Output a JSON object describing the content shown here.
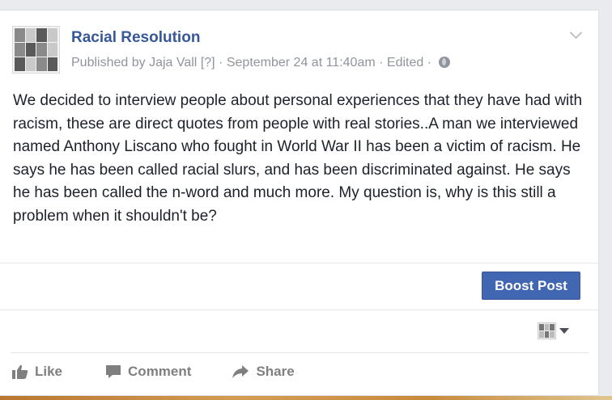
{
  "post": {
    "page_name": "Racial Resolution",
    "meta": {
      "published_by_prefix": "Published by ",
      "author": "Jaja Vall",
      "help_marker": "[?]",
      "separator": "·",
      "timestamp": "September 24 at 11:40am",
      "edited": "Edited"
    },
    "text": "We decided to interview people about personal experiences that they have had with racism, these are direct quotes from people with real stories..A man we interviewed named Anthony Liscano who fought in World War II has been a victim of racism. He says he has been called racial slurs, and has been discriminated against. He says he has been called the n-word and much more. My question is, why is this still a problem when it shouldn't be?",
    "boost_label": "Boost Post"
  },
  "actions": {
    "like": "Like",
    "comment": "Comment",
    "share": "Share"
  },
  "icons": {
    "options": "chevron-down-icon",
    "audience": "globe-icon",
    "like": "thumbs-up-icon",
    "comment": "speech-bubble-icon",
    "share": "share-arrow-icon",
    "actor_menu": "caret-down-icon"
  },
  "colors": {
    "brand_link": "#365899",
    "boost_button": "#4267b2",
    "muted_text": "#90949c",
    "body_text": "#1d2129"
  }
}
